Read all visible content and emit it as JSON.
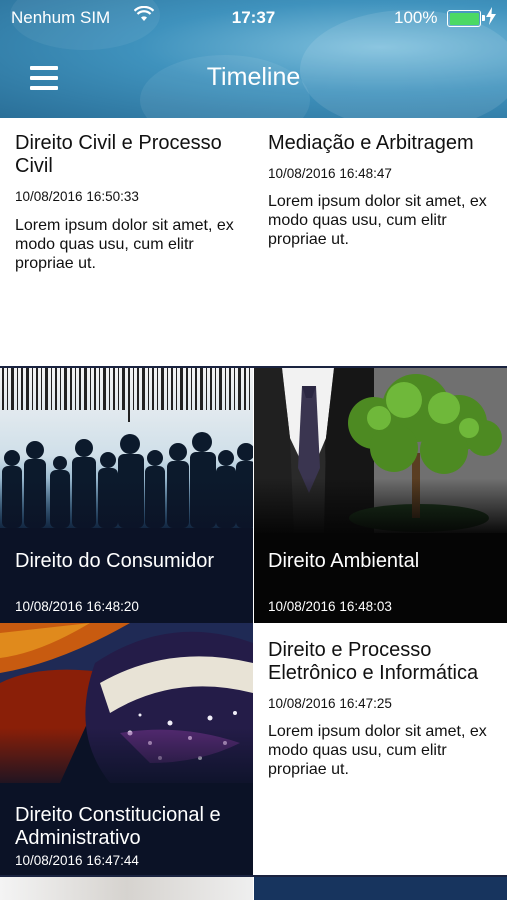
{
  "status_bar": {
    "carrier": "Nenhum SIM",
    "time": "17:37",
    "battery": "100%",
    "battery_color": "#4cd964"
  },
  "header": {
    "title": "Timeline",
    "menu_icon": "hamburger-menu-icon"
  },
  "cards": [
    {
      "title": "Direito Civil e Processo Civil",
      "date": "10/08/2016 16:50:33",
      "body": "Lorem ipsum dolor sit amet, ex modo quas usu, cum elitr propriae ut."
    },
    {
      "title": "Mediação e Arbitragem",
      "date": "10/08/2016 16:48:47",
      "body": "Lorem ipsum dolor sit amet, ex modo quas usu, cum elitr propriae ut."
    },
    {
      "title": "Direito do Consumidor",
      "date": "10/08/2016 16:48:20",
      "image": "barcode-crowd-image"
    },
    {
      "title": "Direito Ambiental",
      "date": "10/08/2016 16:48:03",
      "image": "businessman-tree-image"
    },
    {
      "title": "Direito Constitucional e Administrativo",
      "date": "10/08/2016 16:47:44",
      "image": "brazil-flag-image"
    },
    {
      "title": "Direito e Processo Eletrônico e Informática",
      "date": "10/08/2016 16:47:25",
      "body": "Lorem ipsum dolor sit amet, ex modo quas usu, cum elitr propriae ut."
    }
  ]
}
